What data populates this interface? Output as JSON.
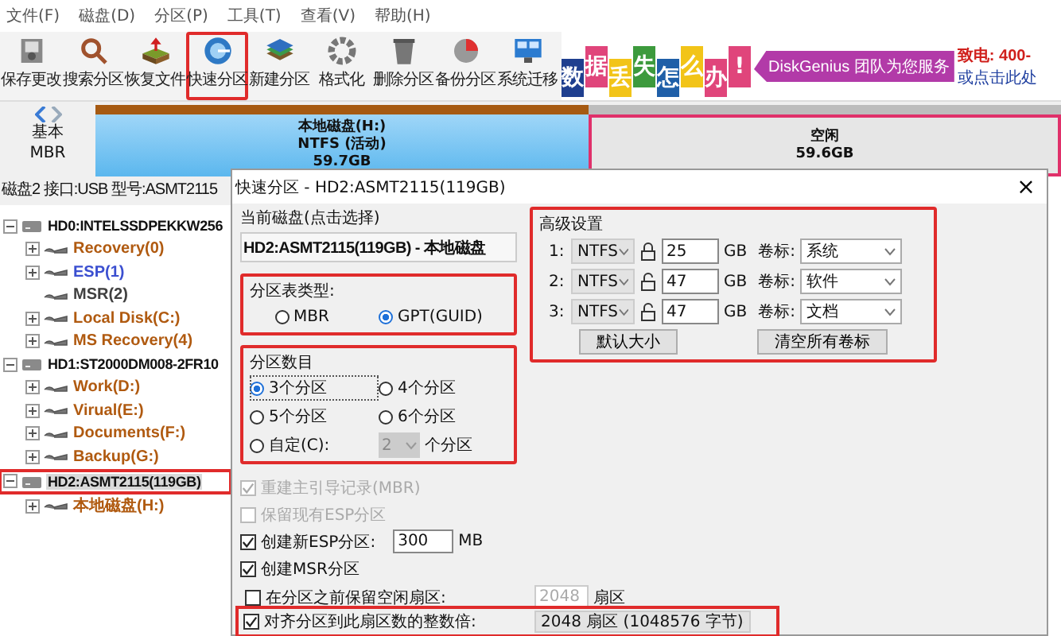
{
  "menu": [
    "文件(F)",
    "磁盘(D)",
    "分区(P)",
    "工具(T)",
    "查看(V)",
    "帮助(H)"
  ],
  "toolbar": [
    {
      "label": "保存更改",
      "kind": "save",
      "selected": false
    },
    {
      "label": "搜索分区",
      "kind": "search",
      "selected": false
    },
    {
      "label": "恢复文件",
      "kind": "restore",
      "selected": false
    },
    {
      "label": "快速分区",
      "kind": "quick",
      "selected": true
    },
    {
      "label": "新建分区",
      "kind": "new",
      "selected": false
    },
    {
      "label": "格式化",
      "kind": "format",
      "selected": false
    },
    {
      "label": "删除分区",
      "kind": "delete",
      "selected": false
    },
    {
      "label": "备份分区",
      "kind": "backup",
      "selected": false
    },
    {
      "label": "系统迁移",
      "kind": "migrate",
      "selected": false
    }
  ],
  "banner": {
    "characters": [
      {
        "text": "数",
        "color": "#1f3f8f"
      },
      {
        "text": "据",
        "color": "#e0457b"
      },
      {
        "text": "丢",
        "color": "#f2c418"
      },
      {
        "text": "失",
        "color": "#3d9a3d"
      },
      {
        "text": "怎",
        "color": "#1f5fa8"
      },
      {
        "text": "么",
        "color": "#f2c418"
      },
      {
        "text": "办",
        "color": "#e0457b"
      },
      {
        "text": "!",
        "color": "#e0457b"
      }
    ],
    "slogan": "DiskGenius 团队为您服务",
    "phone": "致电: 400-",
    "link": "或点击此处"
  },
  "disk_map": {
    "style": "基本",
    "table": "MBR",
    "partitions": [
      {
        "kind": "ntfs",
        "label": "本地磁盘(H:)",
        "fs": "NTFS (活动)",
        "size": "59.7GB",
        "selected": false
      },
      {
        "kind": "free",
        "label": "空闲",
        "size": "59.6GB",
        "selected": true
      }
    ]
  },
  "disk_info": "磁盘2 接口:USB 型号:ASMT2115",
  "tree": [
    {
      "label": "HD0:INTELSSDPEKKW256",
      "expanded": true,
      "selected": false,
      "highlighted": false,
      "children": [
        {
          "label": "Recovery(0)",
          "color": "#b05a10",
          "expandable": true
        },
        {
          "label": "ESP(1)",
          "color": "#3b4fd0",
          "expandable": true
        },
        {
          "label": "MSR(2)",
          "color": "#404040",
          "expandable": false
        },
        {
          "label": "Local Disk(C:)",
          "color": "#b05a10",
          "expandable": true
        },
        {
          "label": "MS Recovery(4)",
          "color": "#b05a10",
          "expandable": true
        }
      ]
    },
    {
      "label": "HD1:ST2000DM008-2FR10",
      "expanded": true,
      "selected": false,
      "highlighted": false,
      "children": [
        {
          "label": "Work(D:)",
          "color": "#b05a10",
          "expandable": true
        },
        {
          "label": "Virual(E:)",
          "color": "#b05a10",
          "expandable": true
        },
        {
          "label": "Documents(F:)",
          "color": "#b05a10",
          "expandable": true
        },
        {
          "label": "Backup(G:)",
          "color": "#b05a10",
          "expandable": true
        }
      ]
    },
    {
      "label": "HD2:ASMT2115(119GB)",
      "expanded": true,
      "selected": true,
      "highlighted": true,
      "children": [
        {
          "label": "本地磁盘(H:)",
          "color": "#b05a10",
          "expandable": true
        }
      ]
    }
  ],
  "dialog": {
    "title": "快速分区 - HD2:ASMT2115(119GB)",
    "close": "×",
    "current_disk": {
      "label": "当前磁盘(点击选择)",
      "value": "HD2:ASMT2115(119GB) - 本地磁盘"
    },
    "table_type": {
      "label": "分区表类型:",
      "highlighted": true,
      "options": [
        {
          "label": "MBR",
          "selected": false
        },
        {
          "label": "GPT(GUID)",
          "selected": true
        }
      ]
    },
    "count": {
      "label": "分区数目",
      "highlighted": true,
      "options": [
        {
          "label": "3个分区",
          "selected": true
        },
        {
          "label": "4个分区",
          "selected": false
        },
        {
          "label": "5个分区",
          "selected": false
        },
        {
          "label": "6个分区",
          "selected": false
        },
        {
          "label": "自定(C):",
          "selected": false
        }
      ],
      "custom_value": "2",
      "custom_unit": "个分区"
    },
    "checks": [
      {
        "label": "重建主引导记录(MBR)",
        "checked": true,
        "disabled": true
      },
      {
        "label": "保留现有ESP分区",
        "checked": false,
        "disabled": true
      },
      {
        "label": "创建新ESP分区:",
        "checked": true,
        "disabled": false,
        "value": "300",
        "unit": "MB"
      },
      {
        "label": "创建MSR分区",
        "checked": true,
        "disabled": false
      }
    ],
    "advanced": {
      "label": "高级设置",
      "highlighted": true,
      "rows": [
        {
          "index": "1:",
          "fs": "NTFS",
          "locked": true,
          "size": "25",
          "unit": "GB",
          "volume_label": "卷标:",
          "volume": "系统"
        },
        {
          "index": "2:",
          "fs": "NTFS",
          "locked": false,
          "size": "47",
          "unit": "GB",
          "volume_label": "卷标:",
          "volume": "软件"
        },
        {
          "index": "3:",
          "fs": "NTFS",
          "locked": false,
          "size": "47",
          "unit": "GB",
          "volume_label": "卷标:",
          "volume": "文档"
        }
      ],
      "buttons": [
        "默认大小",
        "清空所有卷标"
      ]
    },
    "reserve": {
      "label": "在分区之前保留空闲扇区:",
      "checked": false,
      "value": "2048",
      "unit": "扇区",
      "disabled": true
    },
    "align": {
      "label": "对齐分区到此扇区数的整数倍:",
      "checked": true,
      "highlighted": true,
      "value": "2048 扇区 (1048576 字节)"
    }
  }
}
